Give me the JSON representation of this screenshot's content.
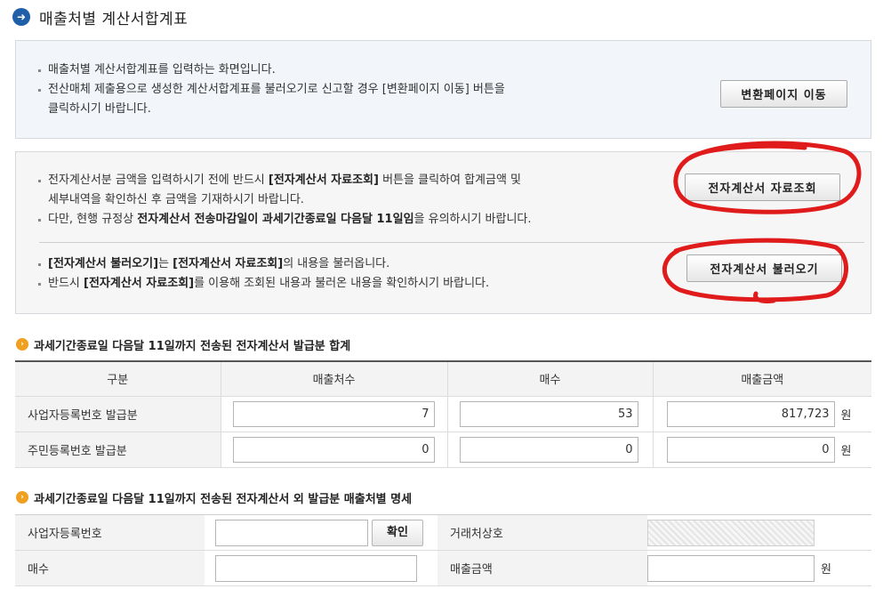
{
  "header": {
    "title": "매출처별 계산서합계표",
    "icon": "arrow-right-circle-icon"
  },
  "box1": {
    "bullets": [
      "매출처별 계산서합계표를 입력하는 화면입니다.",
      "전산매체 제출용으로 생성한 계산서합계표를 불러오기로 신고할 경우 [변환페이지 이동] 버튼을",
      "클릭하시기 바랍니다."
    ],
    "button_label": "변환페이지 이동"
  },
  "box2": {
    "line1_a": "전자계산서분 금액을 입력하시기 전에 반드시 ",
    "line1_b": "[전자계산서 자료조회]",
    "line1_c": " 버튼을 클릭하여 합계금액 및",
    "line1_cont": "세부내역을 확인하신 후 금액을 기재하시기 바랍니다.",
    "line2_a": "다만, 현행 규정상 ",
    "line2_b": "전자계산서 전송마감일이 과세기간종료일 다음달 11일임",
    "line2_c": "을 유의하시기 바랍니다.",
    "line3_a": "[전자계산서 불러오기]",
    "line3_b": "는 ",
    "line3_c": "[전자계산서 자료조회]",
    "line3_d": "의 내용을 불러옵니다.",
    "line4_a": "반드시 ",
    "line4_b": "[전자계산서 자료조회]",
    "line4_c": "를 이용해 조회된 내용과 불러온 내용을 확인하시기 바랍니다.",
    "lookup_button": "전자계산서 자료조회",
    "load_button": "전자계산서 불러오기",
    "annotation_color": "#e01b1b"
  },
  "section1": {
    "title": "과세기간종료일 다음달 11일까지 전송된 전자계산서 발급분 합계",
    "icon": "arrow-circle-icon",
    "columns": [
      "구분",
      "매출처수",
      "매수",
      "매출금액"
    ],
    "rows": [
      {
        "label": "사업자등록번호 발급분",
        "count": "7",
        "sheets": "53",
        "amount": "817,723",
        "unit": "원"
      },
      {
        "label": "주민등록번호 발급분",
        "count": "0",
        "sheets": "0",
        "amount": "0",
        "unit": "원"
      }
    ]
  },
  "section2": {
    "title": "과세기간종료일 다음달 11일까지 전송된 전자계산서 외 발급분 매출처별 명세",
    "icon": "arrow-circle-icon",
    "biz_no_label": "사업자등록번호",
    "confirm_button": "확인",
    "trade_name_label": "거래처상호",
    "sheets_label": "매수",
    "amount_label": "매출금액",
    "unit": "원"
  },
  "colors": {
    "header_icon": "#1f5fa8",
    "section_icon": "#f0a020",
    "annotation": "#e01b1b"
  }
}
